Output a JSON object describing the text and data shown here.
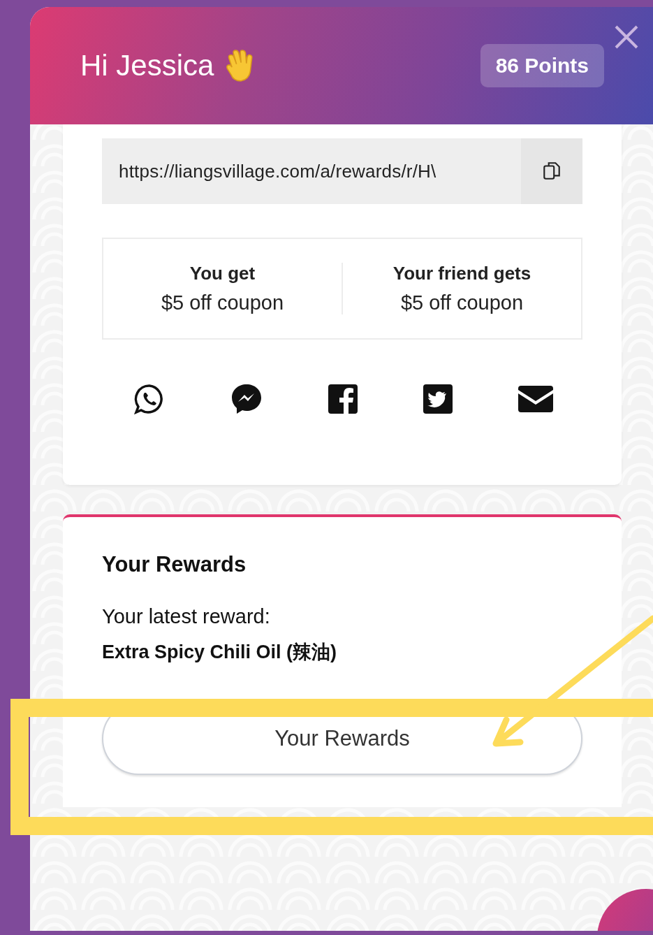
{
  "header": {
    "greeting": "Hi Jessica",
    "points": "86 Points"
  },
  "referral": {
    "link": "https://liangsvillage.com/a/rewards/r/H\\"
  },
  "offers": [
    {
      "label": "You get",
      "value": "$5 off coupon"
    },
    {
      "label": "Your friend gets",
      "value": "$5 off coupon"
    }
  ],
  "rewards_card": {
    "title": "Your Rewards",
    "latest_label": "Your latest reward:",
    "latest_reward": "Extra Spicy Chili Oil (辣油)",
    "button": "Your Rewards"
  }
}
